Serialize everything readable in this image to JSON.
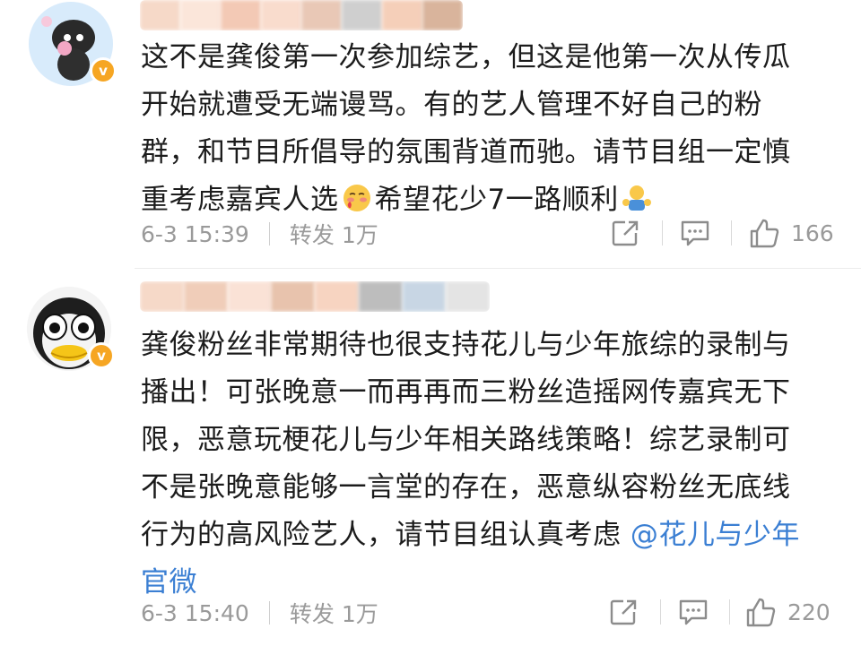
{
  "comments": [
    {
      "verified_badge": "v",
      "text_lines": [
        "这不是龚俊第一次参加综艺，但这是他第一次从传瓜",
        "开始就遭受无端谩骂。有的艺人管理不好自己的粉",
        "群，和节目所倡导的氛围背道而驰。请节目组一定慎"
      ],
      "line4_before": "重考虑嘉宾人选",
      "line4_after": "希望花少7一路顺利",
      "emoji1": "blush-emoji-icon",
      "emoji2": "hug-emoji-icon",
      "time": "6-3 15:39",
      "repost_label": "转发",
      "repost_count": "1万",
      "likes": "166"
    },
    {
      "verified_badge": "v",
      "text_lines": [
        "龚俊粉丝非常期待也很支持花儿与少年旅综的录制与",
        "播出！可张晚意一而再再而三粉丝造摇网传嘉宾无下",
        "限，恶意玩梗花儿与少年相关路线策略！综艺录制可",
        "不是张晚意能够一言堂的存在，恶意纵容粉丝无底线"
      ],
      "line5_text": "行为的高风险艺人，请节目组认真考虑",
      "mention": "@花儿与少年",
      "line6_mention": "官微",
      "time": "6-3 15:40",
      "repost_label": "转发",
      "repost_count": "1万",
      "likes": "220"
    }
  ],
  "colors": {
    "mention": "#3b7fd3",
    "meta_gray": "#9a9a9a",
    "verified_orange": "#f6a623"
  }
}
